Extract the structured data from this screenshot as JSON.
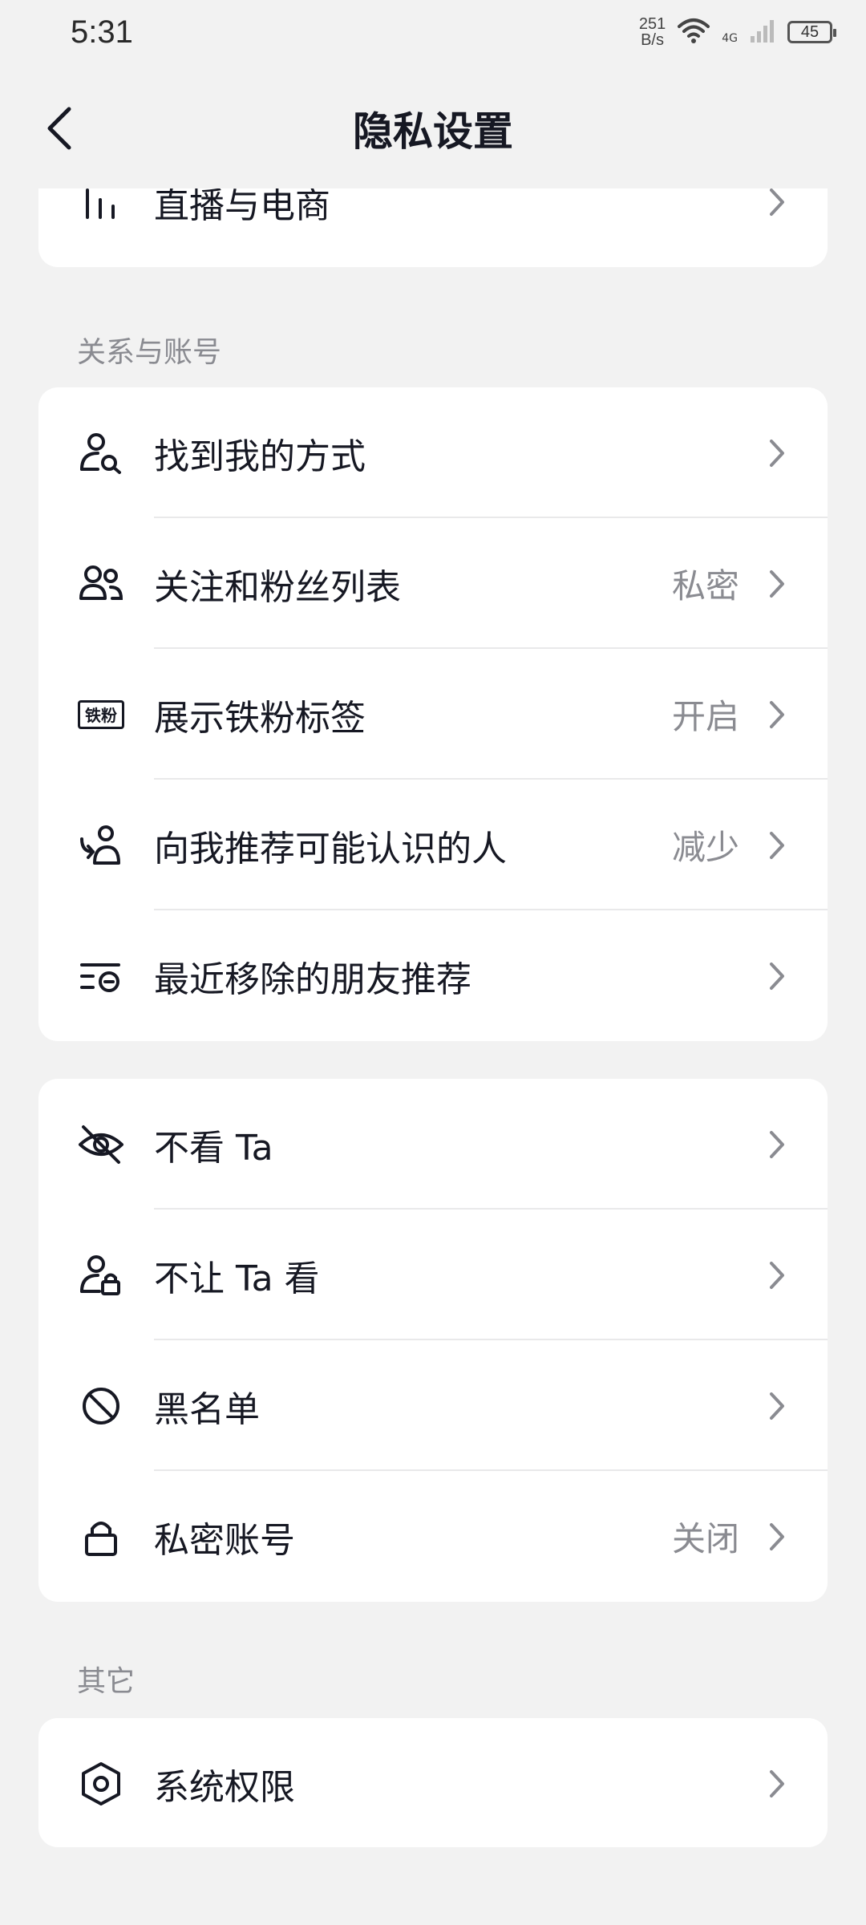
{
  "status_bar": {
    "time": "5:31",
    "net_speed_value": "251",
    "net_speed_unit": "B/s",
    "network_type": "4G",
    "battery": "45"
  },
  "header": {
    "title": "隐私设置"
  },
  "top_card": {
    "items": [
      {
        "label": "直播与电商",
        "icon": "bars-icon",
        "value": ""
      }
    ]
  },
  "section_relations": {
    "title": "关系与账号",
    "items": [
      {
        "label": "找到我的方式",
        "icon": "user-search-icon",
        "value": ""
      },
      {
        "label": "关注和粉丝列表",
        "icon": "users-icon",
        "value": "私密"
      },
      {
        "label": "展示铁粉标签",
        "icon": "tiefen-badge-icon",
        "icon_text": "铁粉",
        "value": "开启"
      },
      {
        "label": "向我推荐可能认识的人",
        "icon": "recommend-user-icon",
        "value": "减少"
      },
      {
        "label": "最近移除的朋友推荐",
        "icon": "list-removed-icon",
        "value": ""
      }
    ]
  },
  "section_blocking": {
    "items": [
      {
        "label": "不看 Ta",
        "icon": "eye-off-icon",
        "value": ""
      },
      {
        "label": "不让 Ta 看",
        "icon": "user-lock-icon",
        "value": ""
      },
      {
        "label": "黑名单",
        "icon": "block-icon",
        "value": ""
      },
      {
        "label": "私密账号",
        "icon": "lock-icon",
        "value": "关闭"
      }
    ]
  },
  "section_other": {
    "title": "其它",
    "items": [
      {
        "label": "系统权限",
        "icon": "hexagon-settings-icon",
        "value": ""
      }
    ]
  }
}
